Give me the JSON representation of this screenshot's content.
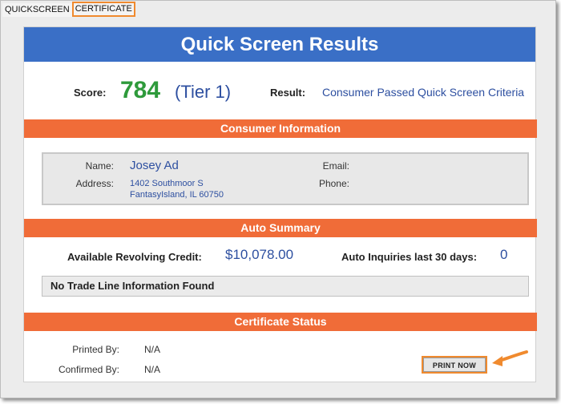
{
  "tabs": [
    {
      "label": "QUICKSCREEN",
      "active": false
    },
    {
      "label": "CERTIFICATE",
      "active": true
    }
  ],
  "header": {
    "title": "Quick Screen Results"
  },
  "score": {
    "label": "Score:",
    "value": "784",
    "tier": "(Tier 1)",
    "result_label": "Result:",
    "result_value": "Consumer Passed Quick Screen Criteria"
  },
  "consumer": {
    "section_title": "Consumer Information",
    "name_label": "Name:",
    "name_value": "Josey Ad",
    "address_label": "Address:",
    "address_line1": "1402 Southmoor S",
    "address_line2": "FantasyIsland, IL 60750",
    "email_label": "Email:",
    "email_value": "",
    "phone_label": "Phone:",
    "phone_value": ""
  },
  "auto": {
    "section_title": "Auto Summary",
    "revolving_label": "Available Revolving Credit:",
    "revolving_value": "$10,078.00",
    "inquiries_label": "Auto Inquiries last 30 days:",
    "inquiries_value": "0",
    "trade_line_message": "No Trade Line Information Found"
  },
  "certificate": {
    "section_title": "Certificate Status",
    "printed_label": "Printed By:",
    "printed_value": "N/A",
    "confirmed_label": "Confirmed By:",
    "confirmed_value": "N/A",
    "print_button": "PRINT NOW"
  },
  "colors": {
    "header_blue": "#3a6fc6",
    "section_orange": "#f06c38",
    "score_green": "#2e9a3b",
    "link_blue": "#2d4fa0",
    "highlight_orange": "#f08a2e"
  }
}
